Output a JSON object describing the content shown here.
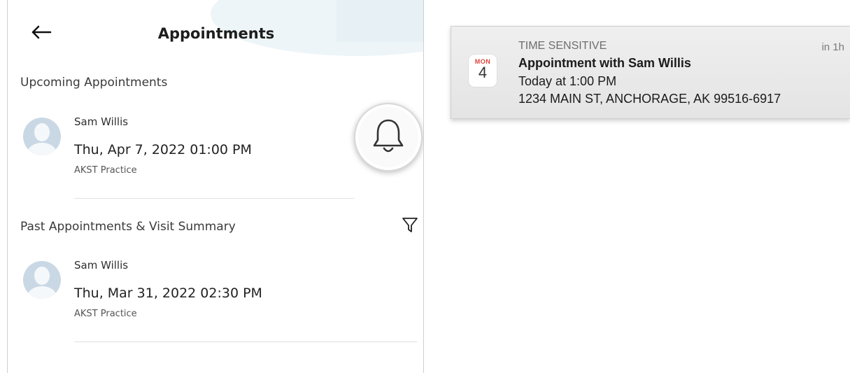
{
  "header": {
    "title": "Appointments",
    "back_icon": "arrow-left-icon"
  },
  "upcoming": {
    "section_label": "Upcoming Appointments",
    "items": [
      {
        "name": "Sam Willis",
        "datetime": "Thu, Apr 7, 2022 01:00 PM",
        "practice": "AKST Practice"
      }
    ]
  },
  "past": {
    "section_label": "Past Appointments & Visit Summary",
    "filter_icon": "filter-icon",
    "items": [
      {
        "name": "Sam Willis",
        "datetime": "Thu, Mar 31, 2022 02:30 PM",
        "practice": "AKST Practice"
      }
    ]
  },
  "bell": {
    "icon": "bell-icon"
  },
  "notification": {
    "category": "TIME SENSITIVE",
    "relative_time": "in 1h",
    "calendar_day": "MON",
    "calendar_date": "4",
    "title": "Appointment with Sam Willis",
    "line1": "Today at 1:00 PM",
    "line2": "1234 MAIN ST, ANCHORAGE, AK 99516-6917"
  },
  "colors": {
    "calendar_red": "#e0443a",
    "avatar_blue": "#c9d8e4",
    "banner_bg": "#e9e9e9"
  }
}
